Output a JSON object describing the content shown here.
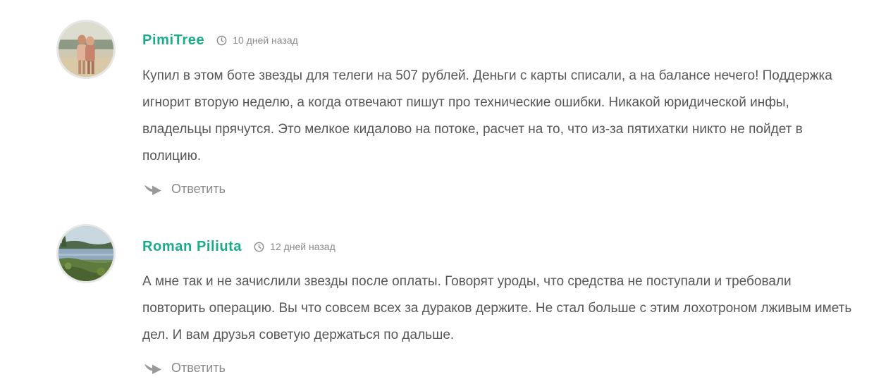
{
  "comments": [
    {
      "author": "PimiTree",
      "time": "10 дней назад",
      "text": "Купил в этом боте звезды для телеги на 507 рублей. Деньги с карты списали, а на балансе нечего! Поддержка игнорит вторую неделю, а когда отвечают пишут про технические ошибки. Никакой юридической инфы, владельцы прячутся. Это мелкое кидалово на потоке, расчет на то, что из-за пятихатки никто не пойдет в полицию.",
      "reply_label": "Ответить",
      "avatar_icon": "user-photo-couple-beach",
      "time_icon": "clock-icon",
      "reply_icon": "reply-arrow-icon"
    },
    {
      "author": "Roman Piliuta",
      "time": "12 дней назад",
      "text": "А мне так и не зачислили звезды после оплаты. Говорят уроды, что средства не поступали и требовали повторить операцию. Вы что совсем всех за дураков держите. Не стал больше с этим лохотроном лживым иметь дел. И вам друзья советую держаться по дальше.",
      "reply_label": "Ответить",
      "avatar_icon": "user-photo-lake-landscape",
      "time_icon": "clock-icon",
      "reply_icon": "reply-arrow-icon"
    }
  ],
  "colors": {
    "author": "#1aab8a",
    "body_text": "#575757",
    "muted": "#8a8a8a",
    "avatar_border": "#e6e6e6"
  }
}
